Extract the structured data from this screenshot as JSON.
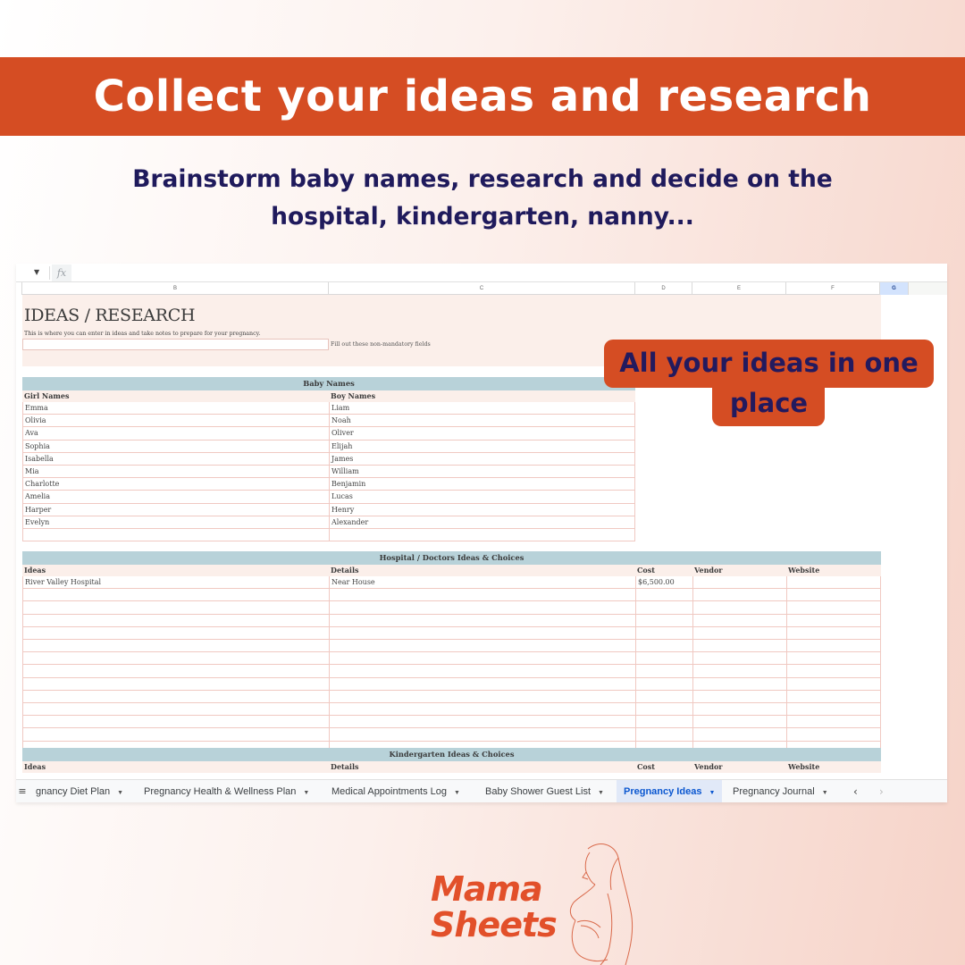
{
  "banner": {
    "title": "Collect your ideas and research",
    "color": "#d54d23"
  },
  "subtitle": {
    "line1": "Brainstorm baby names, research and decide on the",
    "line2": "hospital, kindergarten, nanny..."
  },
  "callout": {
    "line1": "All your ideas in one",
    "line2": "place"
  },
  "sheet": {
    "formula_bar": {
      "name_box_icon": "dropdown-caret-icon",
      "fx_label": "fx"
    },
    "columns": [
      "B",
      "C",
      "D",
      "E",
      "F",
      "G"
    ],
    "selected_column": "G",
    "intro": {
      "title": "IDEAS / RESEARCH",
      "description": "This is where you can enter in ideas and take notes to prepare for your pregnancy.",
      "input_value": "",
      "hint": "Fill out these non-mandatory fields"
    },
    "baby_names": {
      "title": "Baby Names",
      "headers": [
        "Girl Names",
        "Boy Names"
      ],
      "rows": [
        [
          "Emma",
          "Liam"
        ],
        [
          "Olivia",
          "Noah"
        ],
        [
          "Ava",
          "Oliver"
        ],
        [
          "Sophia",
          "Elijah"
        ],
        [
          "Isabella",
          "James"
        ],
        [
          "Mia",
          "William"
        ],
        [
          "Charlotte",
          "Benjamin"
        ],
        [
          "Amelia",
          "Lucas"
        ],
        [
          "Harper",
          "Henry"
        ],
        [
          "Evelyn",
          "Alexander"
        ],
        [
          "",
          ""
        ]
      ]
    },
    "hospital": {
      "title": "Hospital / Doctors Ideas & Choices",
      "headers": [
        "Ideas",
        "Details",
        "Cost",
        "Vendor",
        "Website"
      ],
      "rows": [
        [
          "River Valley Hospital",
          "Near House",
          "$6,500.00",
          "",
          ""
        ],
        [
          "",
          "",
          "",
          "",
          ""
        ],
        [
          "",
          "",
          "",
          "",
          ""
        ],
        [
          "",
          "",
          "",
          "",
          ""
        ],
        [
          "",
          "",
          "",
          "",
          ""
        ],
        [
          "",
          "",
          "",
          "",
          ""
        ],
        [
          "",
          "",
          "",
          "",
          ""
        ],
        [
          "",
          "",
          "",
          "",
          ""
        ],
        [
          "",
          "",
          "",
          "",
          ""
        ],
        [
          "",
          "",
          "",
          "",
          ""
        ],
        [
          "",
          "",
          "",
          "",
          ""
        ],
        [
          "",
          "",
          "",
          "",
          ""
        ],
        [
          "",
          "",
          "",
          "",
          ""
        ],
        [
          "",
          "",
          "",
          "",
          ""
        ]
      ]
    },
    "kindergarten": {
      "title": "Kindergarten Ideas & Choices",
      "headers": [
        "Ideas",
        "Details",
        "Cost",
        "Vendor",
        "Website"
      ]
    },
    "tabs": [
      {
        "label": "gnancy Diet Plan",
        "active": false
      },
      {
        "label": "Pregnancy Health & Wellness Plan",
        "active": false
      },
      {
        "label": "Medical Appointments Log",
        "active": false
      },
      {
        "label": "Baby Shower Guest List",
        "active": false
      },
      {
        "label": "Pregnancy Ideas",
        "active": true
      },
      {
        "label": "Pregnancy Journal",
        "active": false
      }
    ],
    "tab_nav": {
      "prev": "‹",
      "next": "›"
    },
    "all_sheets_icon": "≡"
  },
  "logo": {
    "line1": "Mama",
    "line2": "Sheets",
    "color": "#e2502a"
  }
}
